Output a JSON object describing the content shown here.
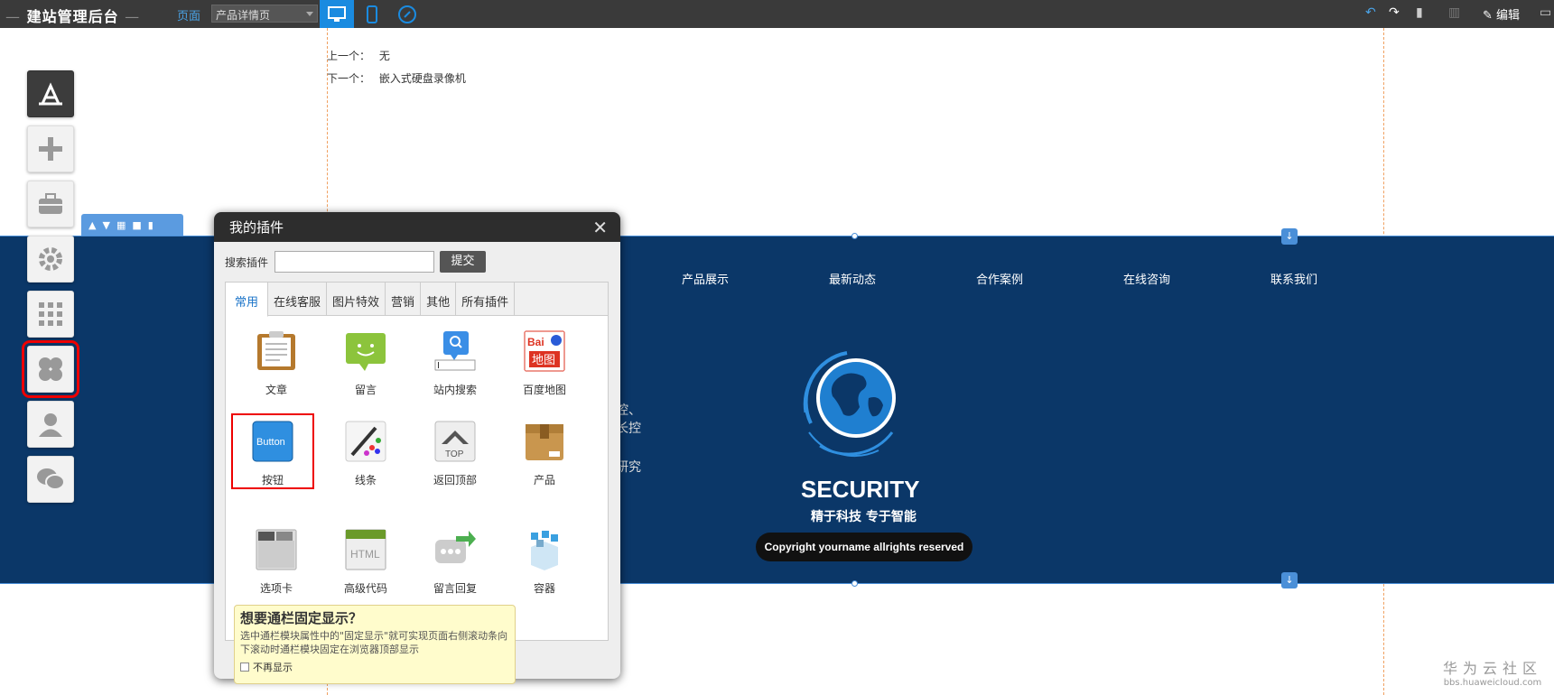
{
  "header": {
    "brand_dash_left": "—",
    "brand": "建站管理后台",
    "brand_dash_right": "—",
    "page_label": "页面",
    "page_select": "产品详情页",
    "edit_label": "编辑"
  },
  "content": {
    "prev_label": "上一个：",
    "prev_value": "无",
    "next_label": "下一个：",
    "next_value": "嵌入式硬盘录像机"
  },
  "banner": {
    "nav": [
      "产品展示",
      "最新动态",
      "合作案例",
      "在线咨询",
      "联系我们"
    ],
    "title": "SECURITY",
    "slogan": "精于科技 专于智能",
    "copyright": "Copyright yourname allrights reserved",
    "partial_text": [
      "控、",
      "长控",
      "",
      "研究"
    ],
    "bg_color": "#0b3768"
  },
  "dialog": {
    "title": "我的插件",
    "search_label": "搜索插件",
    "submit": "提交",
    "tabs": [
      "常用",
      "在线客服",
      "图片特效",
      "营销",
      "其他",
      "所有插件"
    ],
    "plugins": [
      {
        "label": "文章",
        "icon": "article-icon"
      },
      {
        "label": "留言",
        "icon": "message-icon"
      },
      {
        "label": "站内搜索",
        "icon": "site-search-icon"
      },
      {
        "label": "百度地图",
        "icon": "baidu-map-icon"
      },
      {
        "label": "按钮",
        "icon": "button-icon"
      },
      {
        "label": "线条",
        "icon": "line-icon"
      },
      {
        "label": "返回顶部",
        "icon": "back-to-top-icon"
      },
      {
        "label": "产品",
        "icon": "product-icon"
      },
      {
        "label": "选项卡",
        "icon": "tabs-icon"
      },
      {
        "label": "高级代码",
        "icon": "html-code-icon"
      },
      {
        "label": "留言回复",
        "icon": "message-reply-icon"
      },
      {
        "label": "容器",
        "icon": "container-icon"
      }
    ],
    "button_plugin_text": "Button",
    "baidu_text": "Bai",
    "baidu_map_text": "地图",
    "top_text": "TOP",
    "html_text": "HTML"
  },
  "tip": {
    "title": "想要通栏固定显示？",
    "body": "选中通栏模块属性中的\"固定显示\"就可实现页面右侧滚动条向下滚动时通栏模块固定在浏览器顶部显示",
    "checkbox": "不再显示"
  },
  "watermark": {
    "line1": "华为云社区",
    "line2": "bbs.huaweicloud.com"
  }
}
